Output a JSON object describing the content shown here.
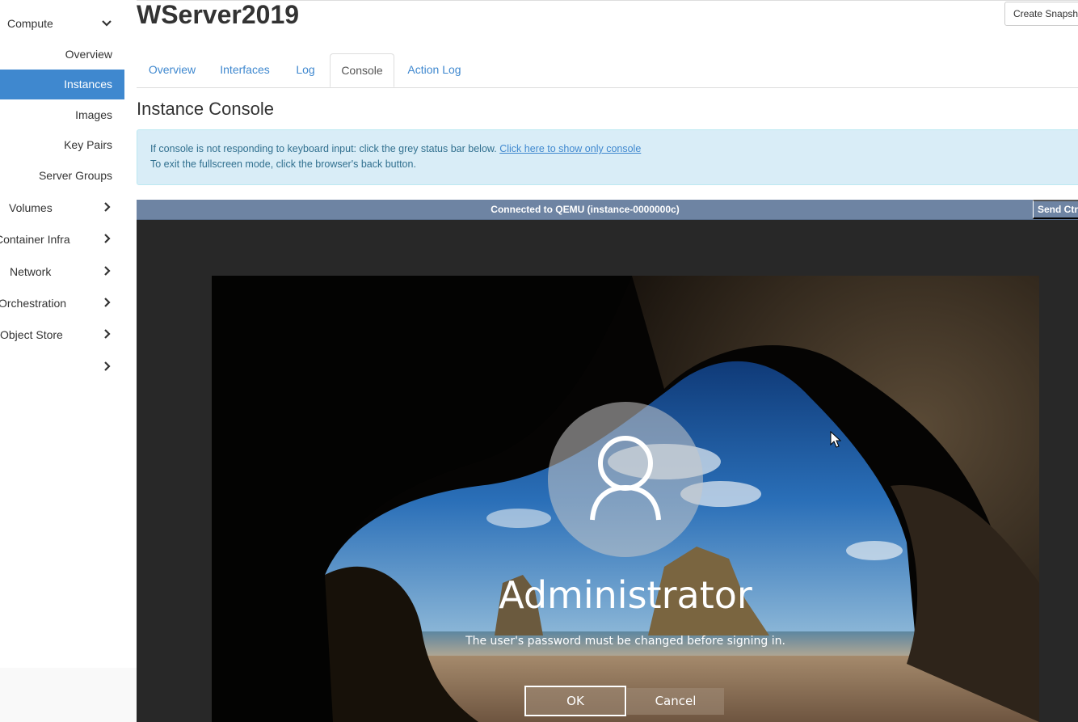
{
  "sidebar": {
    "compute": {
      "label": "Compute"
    },
    "compute_items": [
      {
        "label": "Overview",
        "active": false
      },
      {
        "label": "Instances",
        "active": true
      },
      {
        "label": "Images",
        "active": false
      },
      {
        "label": "Key Pairs",
        "active": false
      },
      {
        "label": "Server Groups",
        "active": false
      }
    ],
    "sections": [
      {
        "label": "Volumes"
      },
      {
        "label": "Container Infra"
      },
      {
        "label": "Network"
      },
      {
        "label": "Orchestration"
      },
      {
        "label": "Object Store"
      },
      {
        "label": ""
      }
    ]
  },
  "header": {
    "title": "WServer2019",
    "snapshot_button": "Create Snapshot"
  },
  "tabs": [
    {
      "label": "Overview",
      "active": false
    },
    {
      "label": "Interfaces",
      "active": false
    },
    {
      "label": "Log",
      "active": false
    },
    {
      "label": "Console",
      "active": true
    },
    {
      "label": "Action Log",
      "active": false
    }
  ],
  "console": {
    "title": "Instance Console",
    "alert_line1": "If console is not responding to keyboard input: click the grey status bar below.",
    "alert_link": "Click here to show only console",
    "alert_line2": "To exit the fullscreen mode, click the browser's back button.",
    "status": "Connected to QEMU (instance-0000000c)",
    "send_cad": "Send CtrlAltDel"
  },
  "login_screen": {
    "username": "Administrator",
    "message": "The user's password must be changed before signing in.",
    "ok_label": "OK",
    "cancel_label": "Cancel"
  },
  "colors": {
    "accent": "#3f88cf",
    "alert_bg": "#d9edf7",
    "statusbar_bg": "#6e84a3",
    "console_bg": "#282828"
  }
}
